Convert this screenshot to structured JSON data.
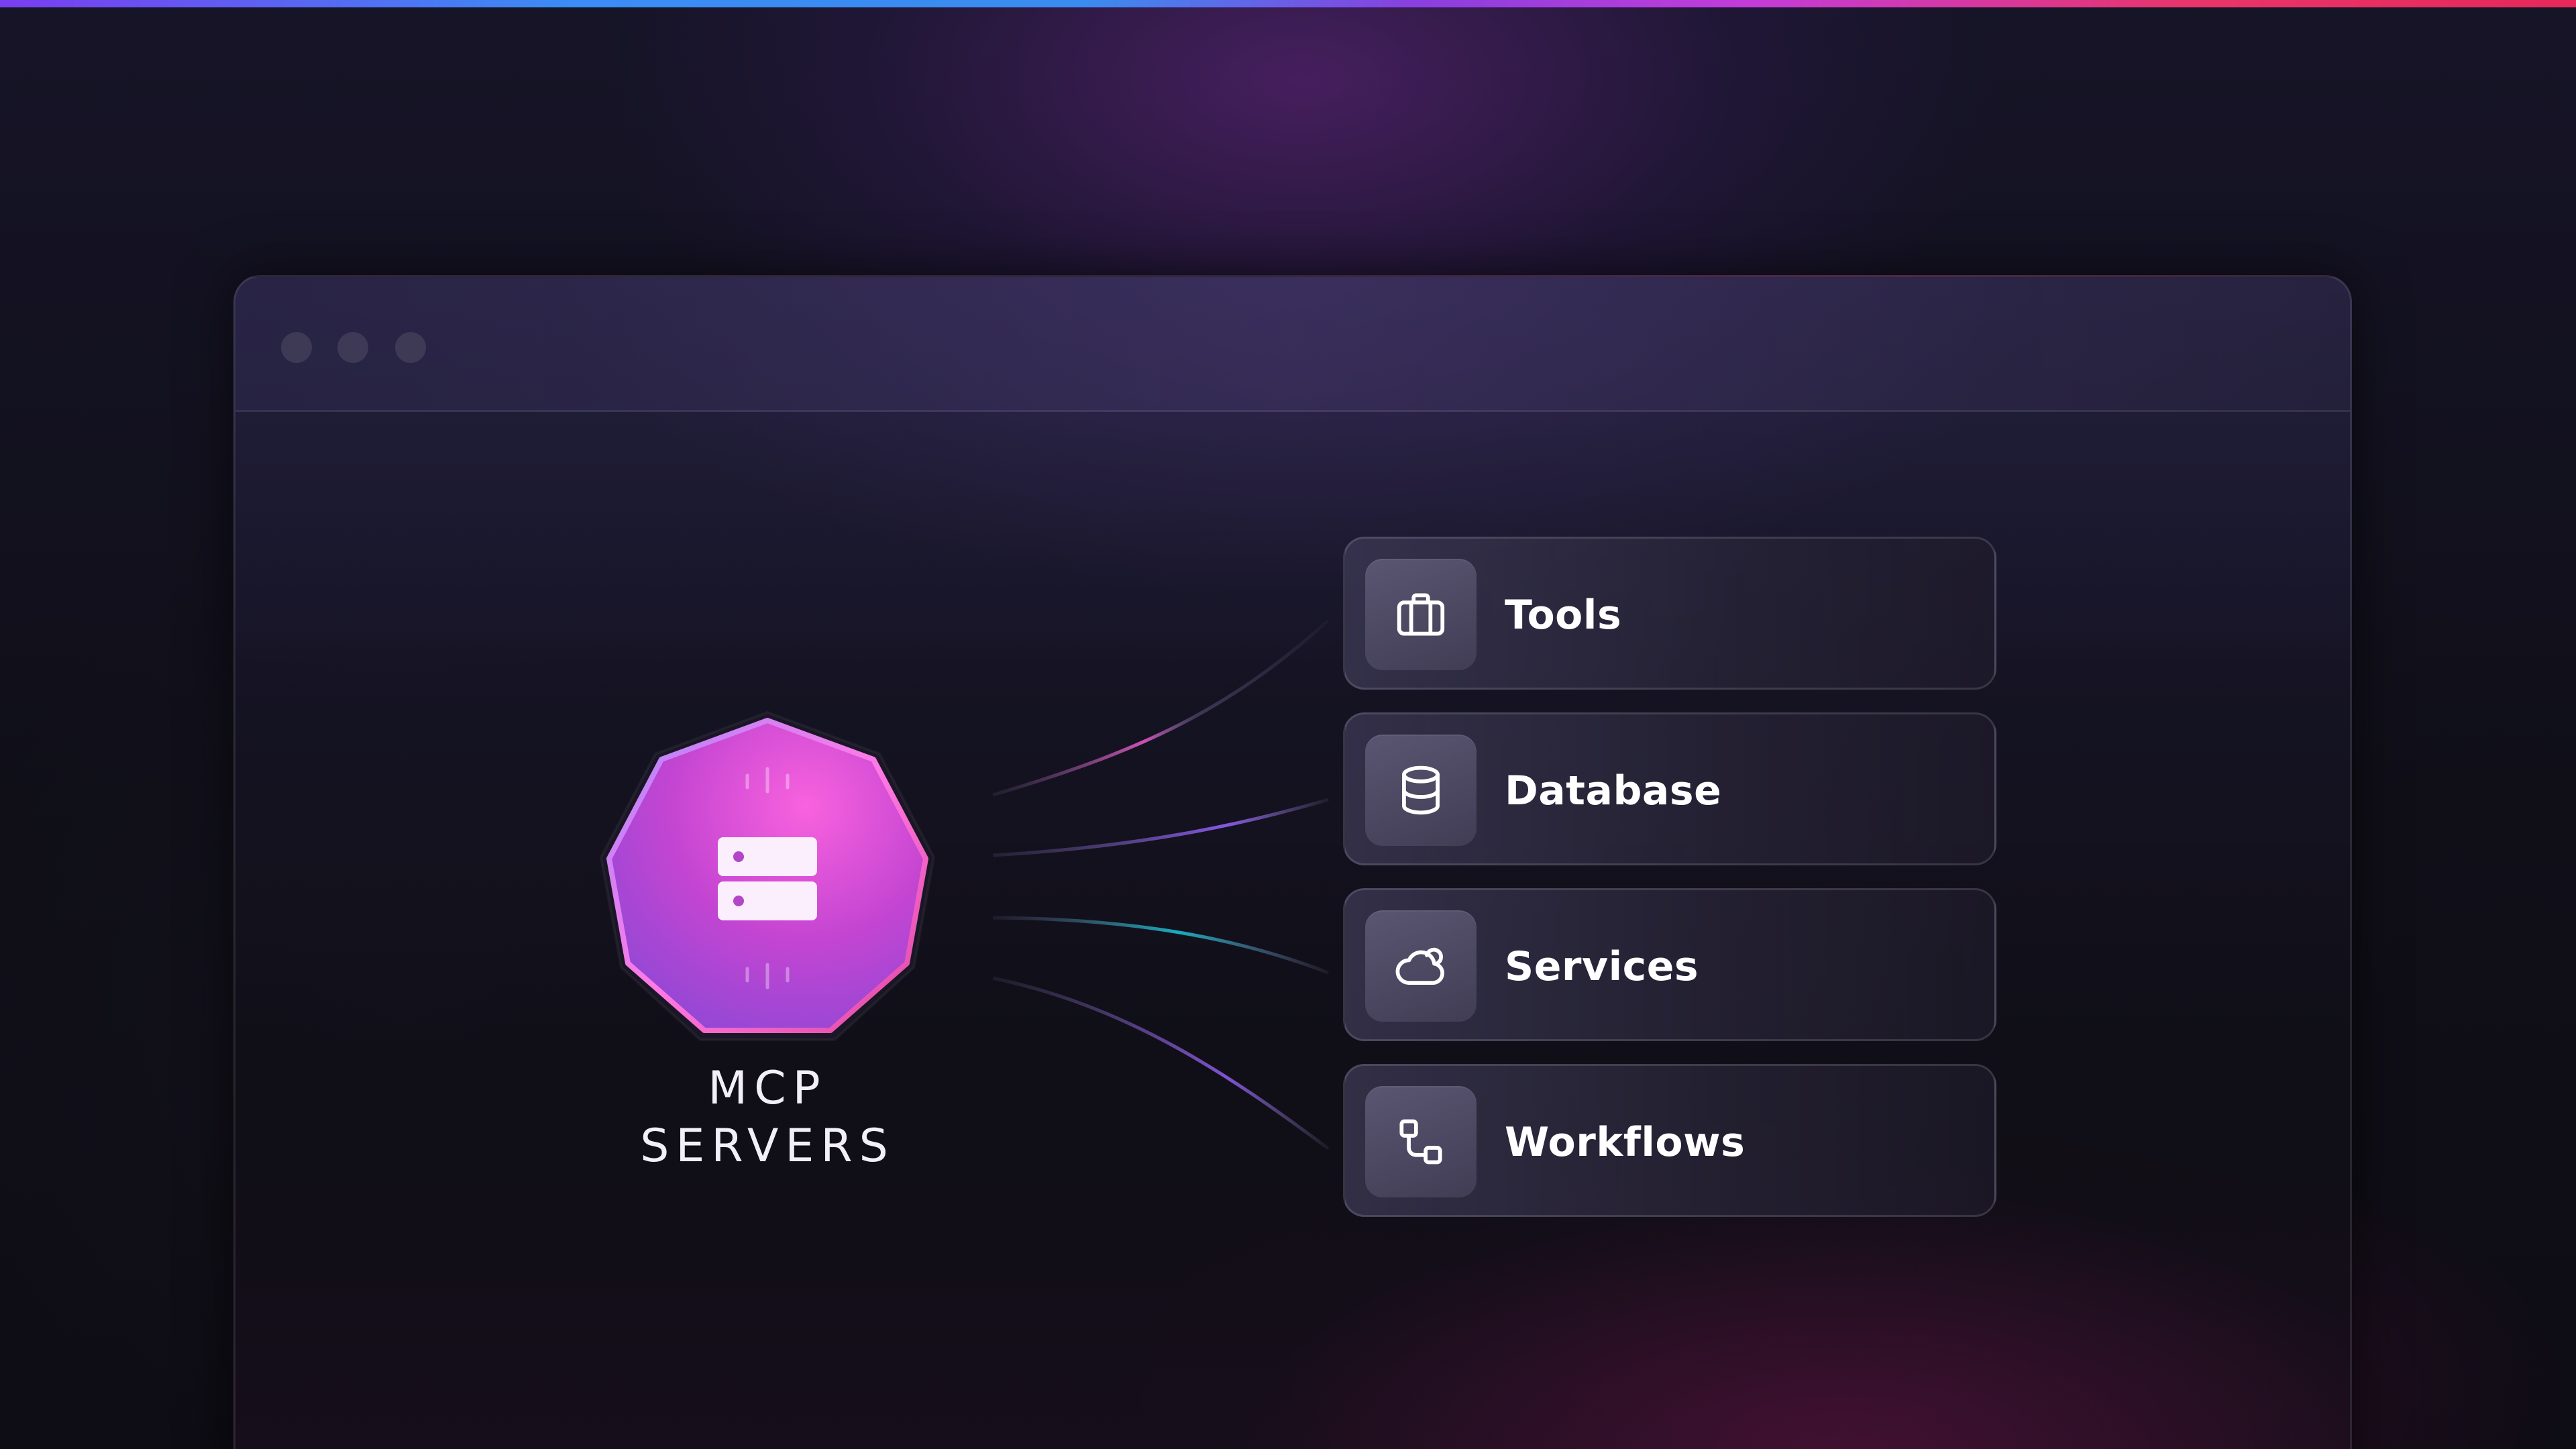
{
  "hub": {
    "line1": "MCP",
    "line2": "SERVERS",
    "icon": "server-icon",
    "gradient": [
      "#f45fd8",
      "#b93fd6",
      "#7b54e8"
    ]
  },
  "cards": [
    {
      "label": "Tools",
      "icon": "briefcase-icon"
    },
    {
      "label": "Database",
      "icon": "database-icon"
    },
    {
      "label": "Services",
      "icon": "cloud-icon"
    },
    {
      "label": "Workflows",
      "icon": "workflow-icon"
    }
  ],
  "colors": {
    "accent_pink": "#e0469e",
    "accent_purple": "#7b54e8",
    "accent_teal": "#19b5c8",
    "top_gradient": [
      "#7a3df0",
      "#3b8cf5",
      "#c33cd9",
      "#e6285a"
    ]
  }
}
